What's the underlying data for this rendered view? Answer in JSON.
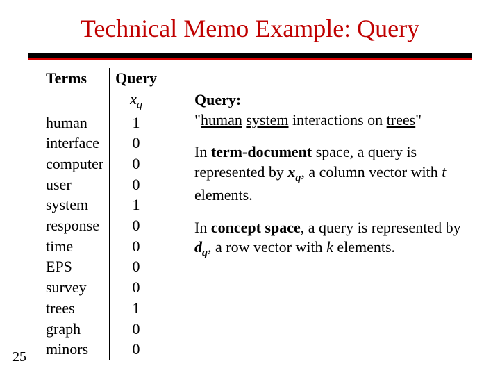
{
  "page_number": "25",
  "title": "Technical Memo Example: Query",
  "table": {
    "head_terms": "Terms",
    "head_query": "Query",
    "subhead_x": "x",
    "subhead_q": "q",
    "rows": [
      {
        "term": "human",
        "val": "1"
      },
      {
        "term": "interface",
        "val": "0"
      },
      {
        "term": "computer",
        "val": "0"
      },
      {
        "term": "user",
        "val": "0"
      },
      {
        "term": "system",
        "val": "1"
      },
      {
        "term": "response",
        "val": "0"
      },
      {
        "term": "time",
        "val": "0"
      },
      {
        "term": "EPS",
        "val": "0"
      },
      {
        "term": "survey",
        "val": "0"
      },
      {
        "term": "trees",
        "val": "1"
      },
      {
        "term": "graph",
        "val": "0"
      },
      {
        "term": "minors",
        "val": "0"
      }
    ]
  },
  "body": {
    "query_label": "Query:",
    "query_q1": "\"",
    "query_w1": "human",
    "query_sp1": " ",
    "query_w2": "system",
    "query_mid": " interactions on ",
    "query_w3": "trees",
    "query_q2": "\"",
    "p1_a": "In ",
    "p1_term": "term-document",
    "p1_b": " space, a query is represented by ",
    "p1_x": "x",
    "p1_q": "q",
    "p1_c": ", a column vector with ",
    "p1_t": "t",
    "p1_d": " elements.",
    "p2_a": "In ",
    "p2_term": "concept space",
    "p2_b": ", a query is represented by ",
    "p2_d2": "d",
    "p2_q": "q",
    "p2_c": ", a row vector with ",
    "p2_k": "k",
    "p2_dend": " elements."
  }
}
